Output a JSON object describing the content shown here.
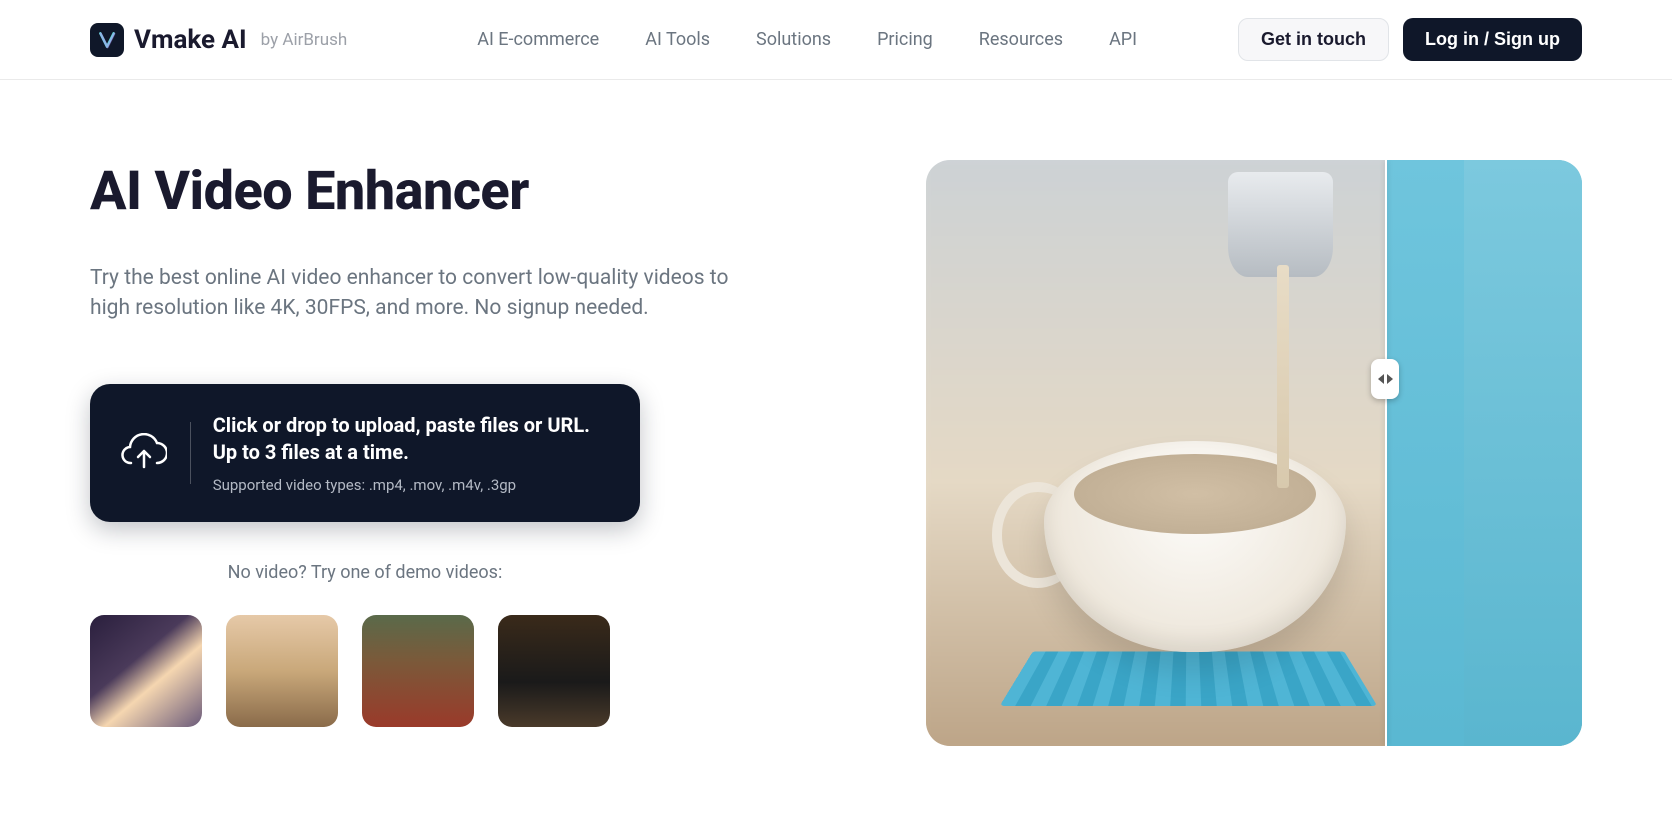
{
  "header": {
    "brand": "Vmake AI",
    "byline": "by AirBrush",
    "nav": [
      "AI E-commerce",
      "AI Tools",
      "Solutions",
      "Pricing",
      "Resources",
      "API"
    ],
    "cta_secondary": "Get in touch",
    "cta_primary": "Log in / Sign up"
  },
  "hero": {
    "title": "AI Video Enhancer",
    "description": "Try the best online AI video enhancer to convert low-quality videos to high resolution like 4K, 30FPS, and more. No signup needed."
  },
  "upload": {
    "main_text": "Click or drop to upload, paste files or URL. Up to 3 files at a time.",
    "sub_text": "Supported video types: .mp4, .mov, .m4v, .3gp"
  },
  "demo": {
    "label": "No video? Try one of demo videos:",
    "thumbs": [
      "demo-portrait",
      "demo-car-desert",
      "demo-autumn-landscape",
      "demo-coffee-cup"
    ]
  }
}
